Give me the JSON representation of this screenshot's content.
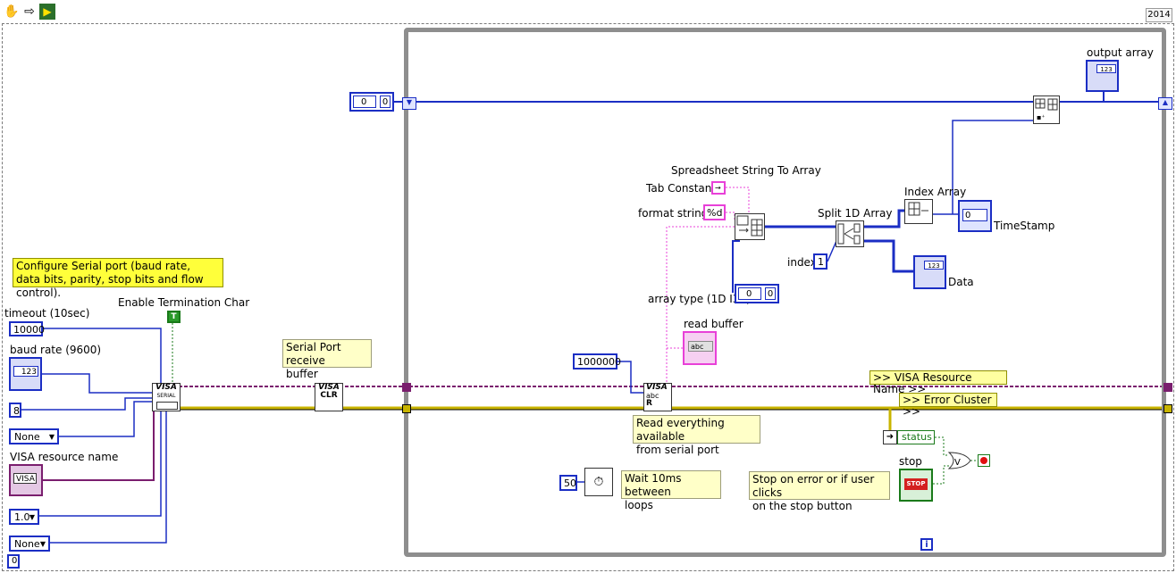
{
  "toolbar": {
    "run_icon": "hand-pan-icon",
    "arrow_icon": "arrow-right-icon",
    "highlight_icon": "highlight-run-icon",
    "version": "2014"
  },
  "constants": {
    "shift_reg_left_value": "0",
    "shift_reg_array_value": "0",
    "timeout_value": "10000",
    "baud_value": "123",
    "data_bits_value": "8",
    "parity_value": "None",
    "visa_value": "VISA",
    "stop_bits_value": "1.0",
    "flow_value": "None",
    "enable_term_value": "T",
    "bytes_value": "1000000",
    "wait_ms_value": "50",
    "index_value": "1",
    "array_type_value": "0",
    "array_type_inner": "0",
    "tab_constant_label": "Tab Constant",
    "format_value": "%d",
    "timestamp_value": "0",
    "flow_bottom_value": "0"
  },
  "labels": {
    "timeout": "timeout (10sec)",
    "baud": "baud rate (9600)",
    "visa_name": "VISA resource name",
    "enable_term": "Enable Termination Char",
    "spreadsheet": "Spreadsheet String To Array",
    "tab_constant": "Tab Constant",
    "format_string": "format string",
    "split_array": "Split 1D Array",
    "index_array": "Index Array",
    "index": "index",
    "timestamp": "TimeStamp",
    "data": "Data",
    "array_type": "array type (1D I32)",
    "read_buffer": "read buffer",
    "output_array": "output array",
    "visa_resource_wire": ">> VISA Resource Name >>",
    "error_cluster_wire": ">> Error Cluster >>",
    "status": "status",
    "stop": "stop",
    "loop_iter": "i"
  },
  "comments": {
    "configure": "Configure Serial port (baud rate,\ndata bits, parity, stop bits and flow control).",
    "receive_buffer": "Serial Port receive\nbuffer",
    "read_all": "Read everything available\nfrom serial port",
    "wait": "Wait 10ms between\nloops",
    "stop_on_error": "Stop on error or if user clicks\non the stop button"
  },
  "nodes": {
    "visa_serial": "VISA",
    "visa_serial_sub": "SERIAL",
    "visa_clr": "VISA",
    "visa_clr_sub": "CLR",
    "visa_read": "VISA",
    "visa_read_sub": "abc",
    "stop_button": "STOP",
    "readbuf_text": "abc"
  },
  "colors": {
    "int_wire": "#1b2ec4",
    "string_wire": "#e840d8",
    "error_wire": "#c8b400",
    "visa_wire": "#7a1e6e",
    "bool_wire": "#1a7a1a",
    "loop_border": "#8e8e8e",
    "note_yellow": "#ffff3a"
  }
}
